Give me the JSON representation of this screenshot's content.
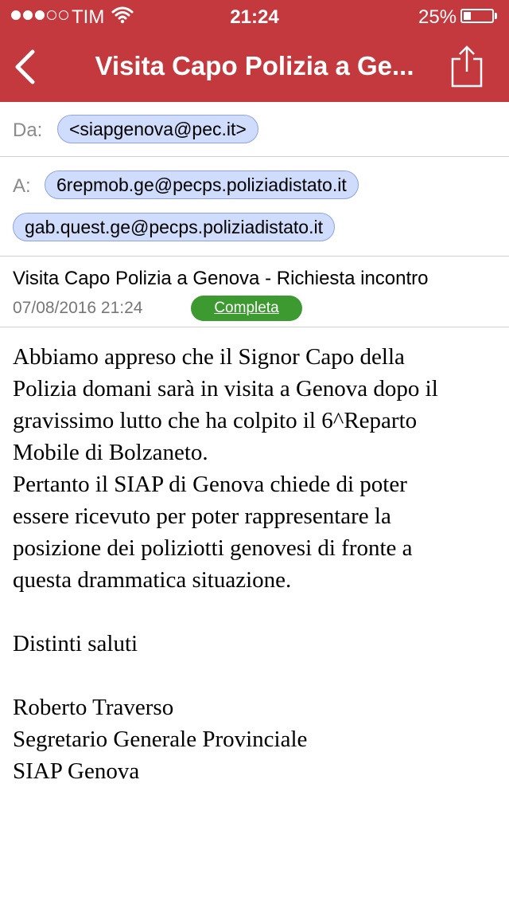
{
  "status_bar": {
    "signal_strength": 3,
    "signal_max": 5,
    "carrier": "TIM",
    "time": "21:24",
    "battery_label": "25%",
    "battery_level": 0.25
  },
  "nav": {
    "title": "Visita Capo Polizia a Ge...",
    "back_icon": "chevron-left-icon",
    "share_icon": "share-icon"
  },
  "header_fields": {
    "from_label": "Da:",
    "from_address": "<siapgenova@pec.it>",
    "to_label": "A:",
    "to_addresses": [
      "6repmob.ge@pecps.poliziadistato.it",
      "gab.quest.ge@pecps.poliziadistato.it"
    ]
  },
  "message": {
    "subject": "Visita Capo Polizia a Genova - Richiesta incontro",
    "date": "07/08/2016 21:24",
    "status": "Completa",
    "body_lines": [
      "Abbiamo appreso che il Signor Capo della",
      "Polizia domani sarà in visita a Genova dopo il",
      "gravissimo lutto che ha colpito il 6^Reparto",
      "Mobile di Bolzaneto.",
      "Pertanto il SIAP di Genova chiede di poter",
      "essere ricevuto per poter rappresentare la",
      "posizione dei poliziotti genovesi di fronte a",
      "questa drammatica situazione.",
      "",
      "Distinti saluti",
      "",
      "Roberto Traverso",
      "Segretario Generale Provinciale",
      "SIAP Genova"
    ]
  },
  "colors": {
    "header_bg": "#c4393d",
    "chip_bg": "#d0dcfb",
    "chip_border": "#8ea4e6",
    "status_badge": "#3c9a30"
  }
}
